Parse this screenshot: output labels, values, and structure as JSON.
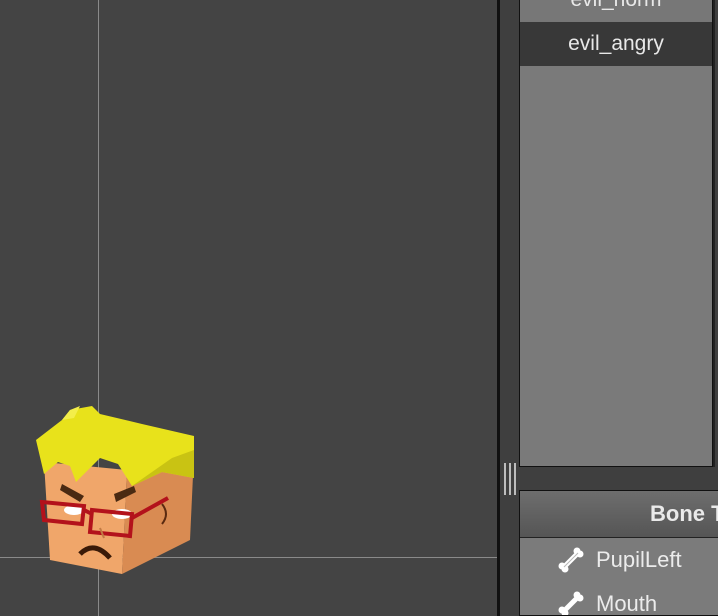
{
  "animations": {
    "items": [
      {
        "label": "evil_norm"
      },
      {
        "label": "evil_angry"
      }
    ],
    "selected": "evil_angry"
  },
  "bone_tree": {
    "header": "Bone T",
    "rows": [
      {
        "label": "PupilLeft",
        "icon": "bone-icon"
      },
      {
        "label": "Mouth",
        "icon": "bone-icon"
      }
    ]
  },
  "colors": {
    "viewport_bg": "#444444",
    "list_bg": "#7a7a7a",
    "selected_bg": "#383838",
    "hair": "#e9e31c",
    "skin": "#f1a56a",
    "glasses": "#b3121b"
  }
}
